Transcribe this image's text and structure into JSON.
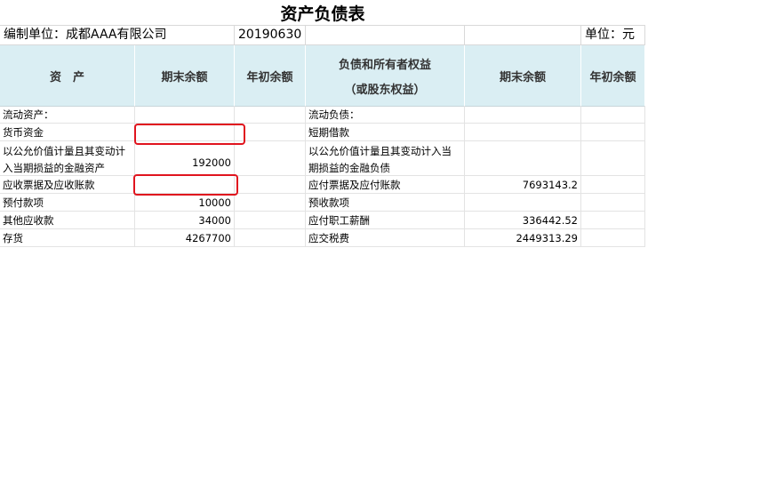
{
  "sheet": {
    "title": "资产负债表",
    "company_label": "编制单位：成都AAA有限公司",
    "date": "20190630",
    "unit_label": "单位：元"
  },
  "header": {
    "assets": "资　产",
    "end_balance": "期末余额",
    "begin_balance": "年初余额",
    "liabilities_line1": "负债和所有者权益",
    "liabilities_line2": "（或股东权益）",
    "end_balance_right": "期末余额",
    "begin_balance_right": "年初余额"
  },
  "rows": [
    {
      "asset": "流动资产：",
      "asset_end": "",
      "asset_begin": "",
      "liab": "流动负债：",
      "liab_end": "",
      "liab_begin": ""
    },
    {
      "asset": "货币资金",
      "asset_end": "",
      "asset_begin": "",
      "liab": "短期借款",
      "liab_end": "",
      "liab_begin": ""
    },
    {
      "asset": "以公允价值计量且其变动计入当期损益的金融资产",
      "asset_end": "192000",
      "asset_begin": "",
      "liab": "以公允价值计量且其变动计入当期损益的金融负债",
      "liab_end": "",
      "liab_begin": ""
    },
    {
      "asset": "应收票据及应收账款",
      "asset_end": "",
      "asset_begin": "",
      "liab": "应付票据及应付账款",
      "liab_end": "7693143.2",
      "liab_begin": ""
    },
    {
      "asset": "预付款项",
      "asset_end": "10000",
      "asset_begin": "",
      "liab": "预收款项",
      "liab_end": "",
      "liab_begin": ""
    },
    {
      "asset": "其他应收款",
      "asset_end": "34000",
      "asset_begin": "",
      "liab": "应付职工薪酬",
      "liab_end": "336442.52",
      "liab_begin": ""
    },
    {
      "asset": "存货",
      "asset_end": "4267700",
      "asset_begin": "",
      "liab": "应交税费",
      "liab_end": "2449313.29",
      "liab_begin": ""
    }
  ],
  "highlight_color": "#e0141e",
  "header_bg": "#daeef3"
}
